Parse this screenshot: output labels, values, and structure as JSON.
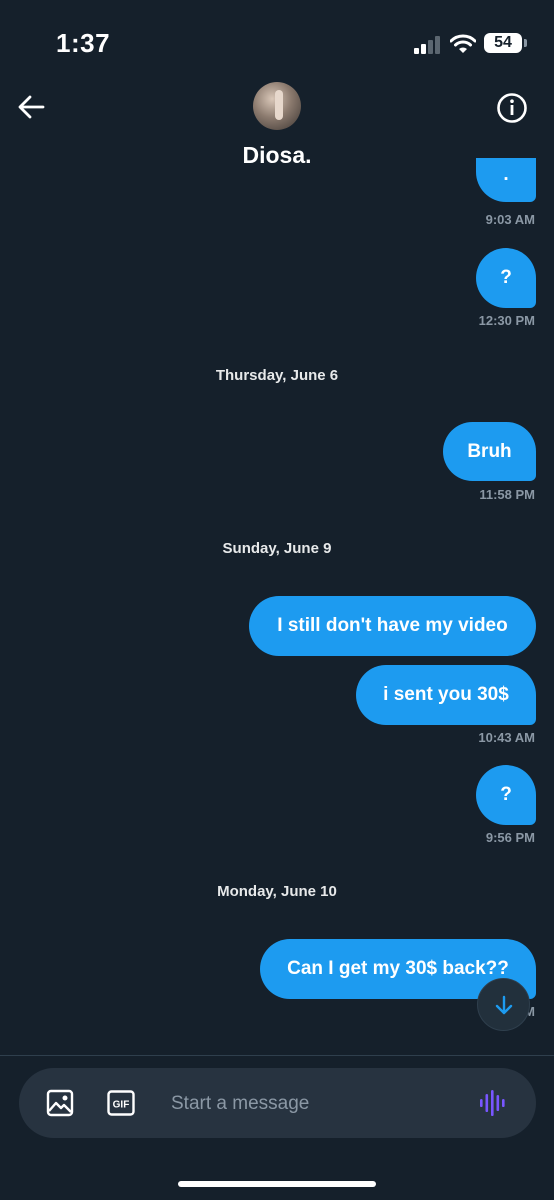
{
  "status_bar": {
    "time": "1:37",
    "battery": "54"
  },
  "header": {
    "contact_name": "Diosa."
  },
  "messages": [
    {
      "text": ".",
      "time": "9:03 AM"
    },
    {
      "text": "?",
      "time": "12:30 PM"
    },
    {
      "date": "Thursday, June 6"
    },
    {
      "text": "Bruh",
      "time": "11:58 PM"
    },
    {
      "date": "Sunday, June 9"
    },
    {
      "text": "I still don't have my video"
    },
    {
      "text": "i sent you 30$",
      "time": "10:43 AM"
    },
    {
      "text": "?",
      "time": "9:56 PM"
    },
    {
      "date": "Monday, June 10"
    },
    {
      "text": "Can I get my 30$ back??",
      "time_partial": "M"
    }
  ],
  "composer": {
    "placeholder": "Start a message",
    "gif_label": "GIF"
  },
  "colors": {
    "background": "#15202b",
    "bubble": "#1d9bf0",
    "timestamp": "#8b98a5",
    "composer": "#273340",
    "voice_icon": "#7856ff"
  },
  "icons": [
    "back-arrow-icon",
    "info-icon",
    "image-icon",
    "gif-icon",
    "voice-waveform-icon",
    "arrow-down-icon",
    "cellular-signal-icon",
    "wifi-icon",
    "battery-icon"
  ]
}
